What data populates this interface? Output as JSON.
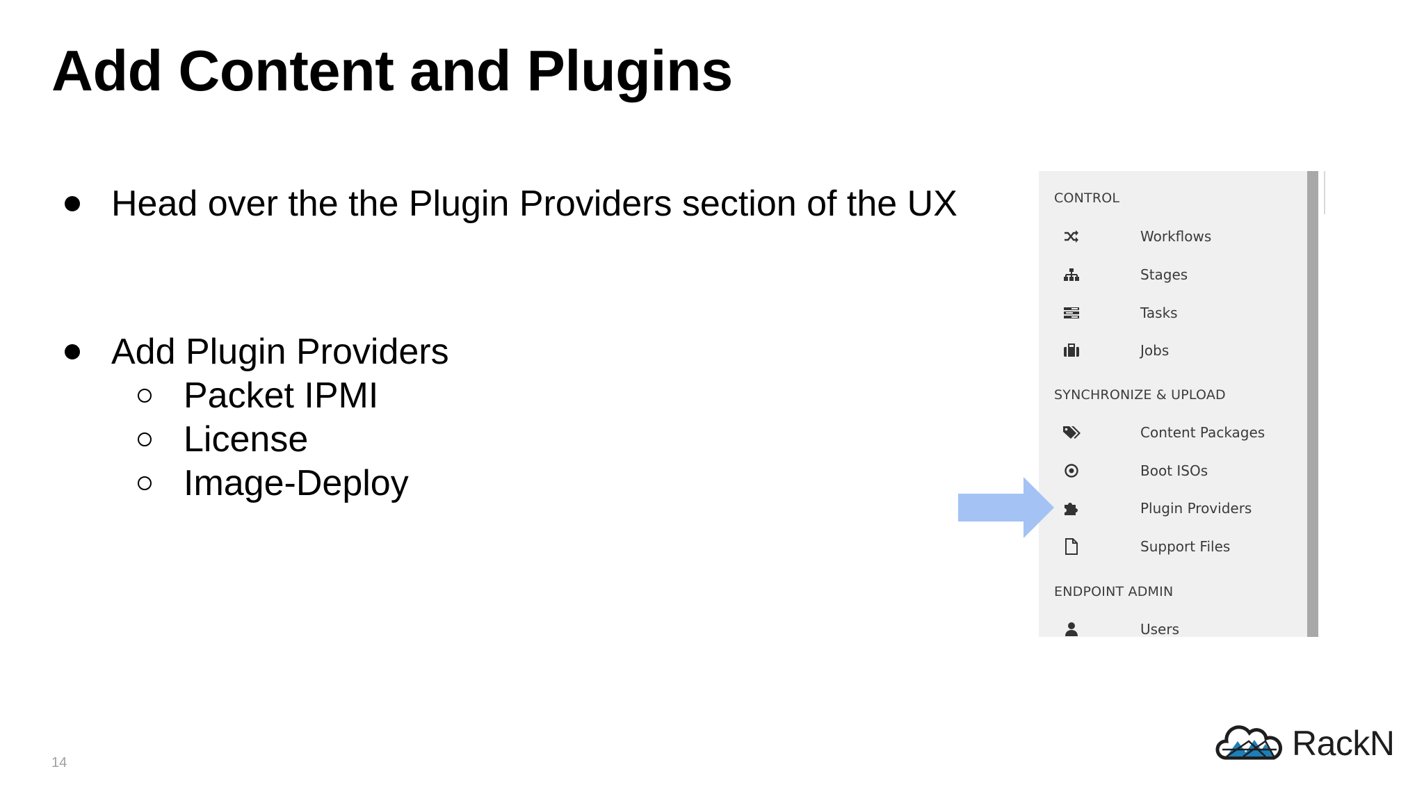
{
  "slide": {
    "title": "Add Content and Plugins",
    "page_number": "14"
  },
  "bullets": [
    {
      "level": 1,
      "text": "Head over the the Plugin Providers section of the UX"
    },
    {
      "level": 1,
      "text": "Add Plugin Providers"
    },
    {
      "level": 2,
      "text": "Packet IPMI"
    },
    {
      "level": 2,
      "text": "License"
    },
    {
      "level": 2,
      "text": "Image-Deploy"
    }
  ],
  "sidebar": {
    "sections": [
      {
        "label": "CONTROL"
      },
      {
        "label": "SYNCHRONIZE & UPLOAD"
      },
      {
        "label": "ENDPOINT ADMIN"
      }
    ],
    "items": [
      {
        "label": "Workflows",
        "icon": "shuffle-icon"
      },
      {
        "label": "Stages",
        "icon": "sitemap-icon"
      },
      {
        "label": "Tasks",
        "icon": "tasks-icon"
      },
      {
        "label": "Jobs",
        "icon": "briefcase-icon"
      },
      {
        "label": "Content Packages",
        "icon": "tags-icon"
      },
      {
        "label": "Boot ISOs",
        "icon": "dot-circle-icon"
      },
      {
        "label": "Plugin Providers",
        "icon": "puzzle-icon"
      },
      {
        "label": "Support Files",
        "icon": "file-icon"
      },
      {
        "label": "Users",
        "icon": "user-icon"
      }
    ],
    "highlight": "Plugin Providers"
  },
  "logo": {
    "text": "RackN"
  },
  "colors": {
    "arrow": "#a4c2f4",
    "sidebar_bg": "#f0f0f0",
    "scrollbar": "#a8a8a8",
    "logo_blue": "#1d7fb8"
  }
}
